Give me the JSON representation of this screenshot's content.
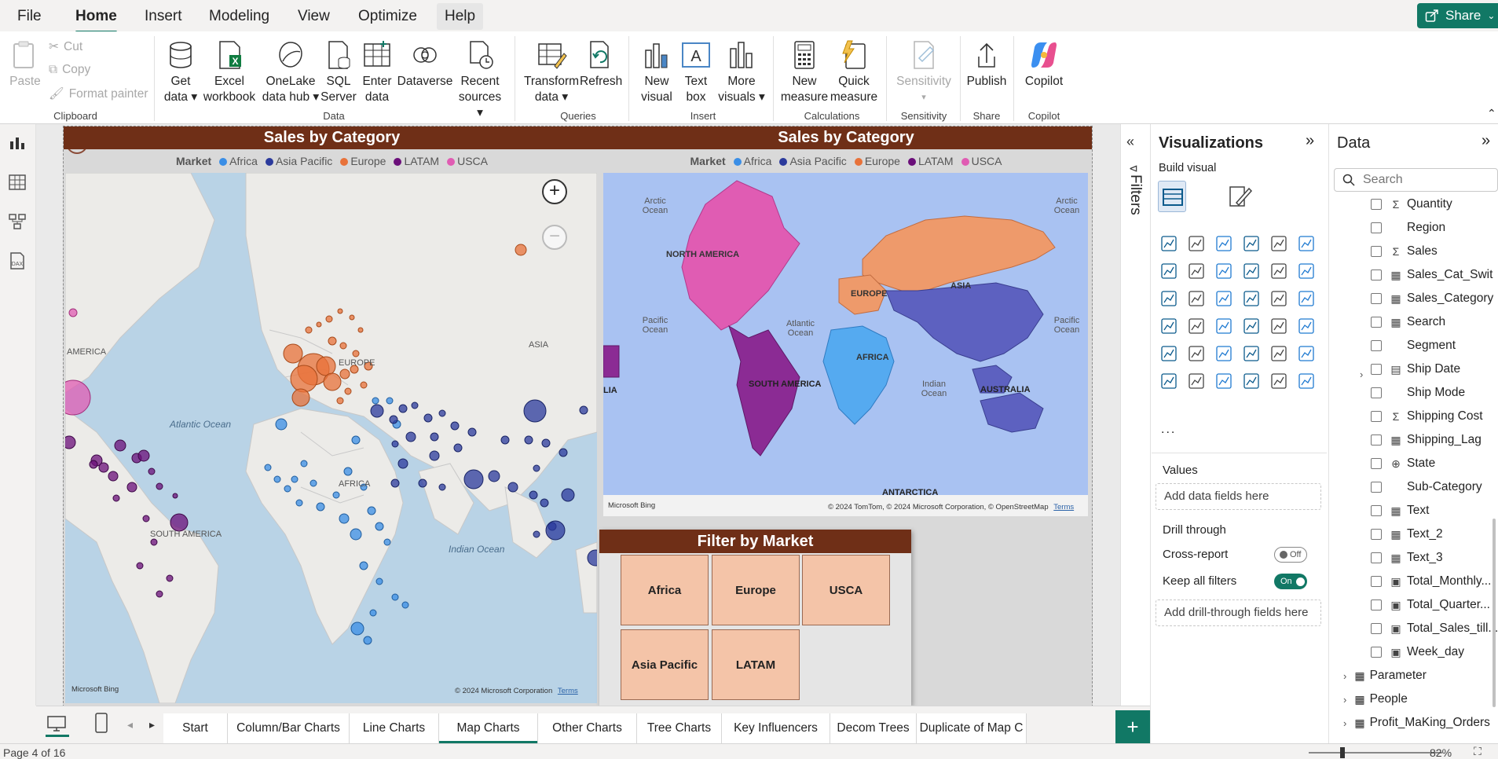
{
  "menu": {
    "tabs": [
      {
        "label": "File"
      },
      {
        "label": "Home"
      },
      {
        "label": "Insert"
      },
      {
        "label": "Modeling"
      },
      {
        "label": "View"
      },
      {
        "label": "Optimize"
      },
      {
        "label": "Help"
      }
    ],
    "share_label": "Share"
  },
  "ribbon": {
    "clipboard": {
      "paste": "Paste",
      "cut": "Cut",
      "copy": "Copy",
      "format_painter": "Format painter",
      "group": "Clipboard"
    },
    "data": {
      "get_data": [
        "Get",
        "data ▾"
      ],
      "excel": [
        "Excel",
        "workbook"
      ],
      "onelake": [
        "OneLake",
        "data hub ▾"
      ],
      "sql": [
        "SQL",
        "Server"
      ],
      "enter": [
        "Enter",
        "data"
      ],
      "dataverse": [
        "Dataverse",
        ""
      ],
      "recent": [
        "Recent",
        "sources ▾"
      ],
      "group": "Data"
    },
    "queries": {
      "transform": [
        "Transform",
        "data ▾"
      ],
      "refresh": [
        "Refresh",
        ""
      ],
      "group": "Queries"
    },
    "insert": {
      "new_visual": [
        "New",
        "visual"
      ],
      "text_box": [
        "Text",
        "box"
      ],
      "more_visuals": [
        "More",
        "visuals ▾"
      ],
      "group": "Insert"
    },
    "calculations": {
      "new_measure": [
        "New",
        "measure"
      ],
      "quick_measure": [
        "Quick",
        "measure"
      ],
      "group": "Calculations"
    },
    "sensitivity": {
      "label": [
        "Sensitivity",
        "▾"
      ],
      "group": "Sensitivity"
    },
    "share": {
      "publish": [
        "Publish",
        ""
      ],
      "group": "Share"
    },
    "copilot": {
      "label": [
        "Copilot",
        ""
      ],
      "group": "Copilot"
    }
  },
  "report": {
    "left_map": {
      "title": "Sales by Category",
      "legend_title": "Market",
      "legend": [
        {
          "name": "Africa",
          "color": "#3a8ee6"
        },
        {
          "name": "Asia Pacific",
          "color": "#2b3a9c"
        },
        {
          "name": "Europe",
          "color": "#e8723a"
        },
        {
          "name": "LATAM",
          "color": "#6b0f7a"
        },
        {
          "name": "USCA",
          "color": "#e05cb3"
        }
      ],
      "labels": {
        "america": "AMERICA",
        "europe": "EUROPE",
        "asia": "ASIA",
        "africa": "AFRICA",
        "south_america": "SOUTH AMERICA"
      },
      "oceans": {
        "atlantic": "Atlantic Ocean",
        "indian": "Indian Ocean"
      },
      "bing": "Microsoft Bing",
      "copyright": "© 2024 Microsoft Corporation",
      "terms": "Terms"
    },
    "right_map": {
      "title": "Sales by Category",
      "legend_title": "Market",
      "labels": {
        "north_america": "NORTH AMERICA",
        "europe": "EUROPE",
        "asia": "ASIA",
        "africa": "AFRICA",
        "south_america": "SOUTH AMERICA",
        "australia": "AUSTRALIA",
        "antarctica": "ANTARCTICA",
        "lia": "LIA"
      },
      "oceans": {
        "arctic_l": "Arctic Ocean",
        "arctic_r": "Arctic Ocean",
        "pacific_l": "Pacific Ocean",
        "pacific_r": "Pacific Ocean",
        "atlantic": "Atlantic Ocean",
        "indian": "Indian Ocean"
      },
      "bing": "Microsoft Bing",
      "copyright": "© 2024 TomTom, © 2024 Microsoft Corporation, © OpenStreetMap",
      "terms": "Terms"
    },
    "filter": {
      "title": "Filter by Market",
      "tiles": [
        "Africa",
        "Europe",
        "USCA",
        "Asia Pacific",
        "LATAM"
      ]
    }
  },
  "filters_label": "Filters",
  "visualizations": {
    "title": "Visualizations",
    "build_visual": "Build visual",
    "values_label": "Values",
    "values_placeholder": "Add data fields here",
    "drill_through": "Drill through",
    "cross_report": "Cross-report",
    "cross_report_state": "Off",
    "keep_filters": "Keep all filters",
    "keep_filters_state": "On",
    "drill_placeholder": "Add drill-through fields here",
    "more": "..."
  },
  "data_pane": {
    "title": "Data",
    "search_placeholder": "Search",
    "fields": [
      {
        "name": "Quantity",
        "type": "Σ"
      },
      {
        "name": "Region",
        "type": ""
      },
      {
        "name": "Sales",
        "type": "Σ"
      },
      {
        "name": "Sales_Cat_Swit",
        "type": "▦"
      },
      {
        "name": "Sales_Category",
        "type": "▦"
      },
      {
        "name": "Search",
        "type": "▦"
      },
      {
        "name": "Segment",
        "type": ""
      },
      {
        "name": "Ship Date",
        "type": "▤"
      },
      {
        "name": "Ship Mode",
        "type": ""
      },
      {
        "name": "Shipping Cost",
        "type": "Σ"
      },
      {
        "name": "Shipping_Lag",
        "type": "▦"
      },
      {
        "name": "State",
        "type": "⊕"
      },
      {
        "name": "Sub-Category",
        "type": ""
      },
      {
        "name": "Text",
        "type": "▦"
      },
      {
        "name": "Text_2",
        "type": "▦"
      },
      {
        "name": "Text_3",
        "type": "▦"
      },
      {
        "name": "Total_Monthly...",
        "type": "▣"
      },
      {
        "name": "Total_Quarter...",
        "type": "▣"
      },
      {
        "name": "Total_Sales_till...",
        "type": "▣"
      },
      {
        "name": "Week_day",
        "type": "▣"
      }
    ],
    "tables": [
      "Parameter",
      "People",
      "Profit_MaKing_Orders"
    ]
  },
  "page_tabs": [
    "Start",
    "Column/Bar Charts",
    "Line Charts",
    "Map Charts",
    "Other Charts",
    "Tree Charts",
    "Key Influencers",
    "Decom Trees",
    "Duplicate of Map C"
  ],
  "active_tab": "Map Charts",
  "status": {
    "page": "Page 4 of 16",
    "zoom": "82%"
  },
  "colors": {
    "accent": "#117865",
    "title_bar": "#6f2f17",
    "tile": "#f4c4a8"
  }
}
